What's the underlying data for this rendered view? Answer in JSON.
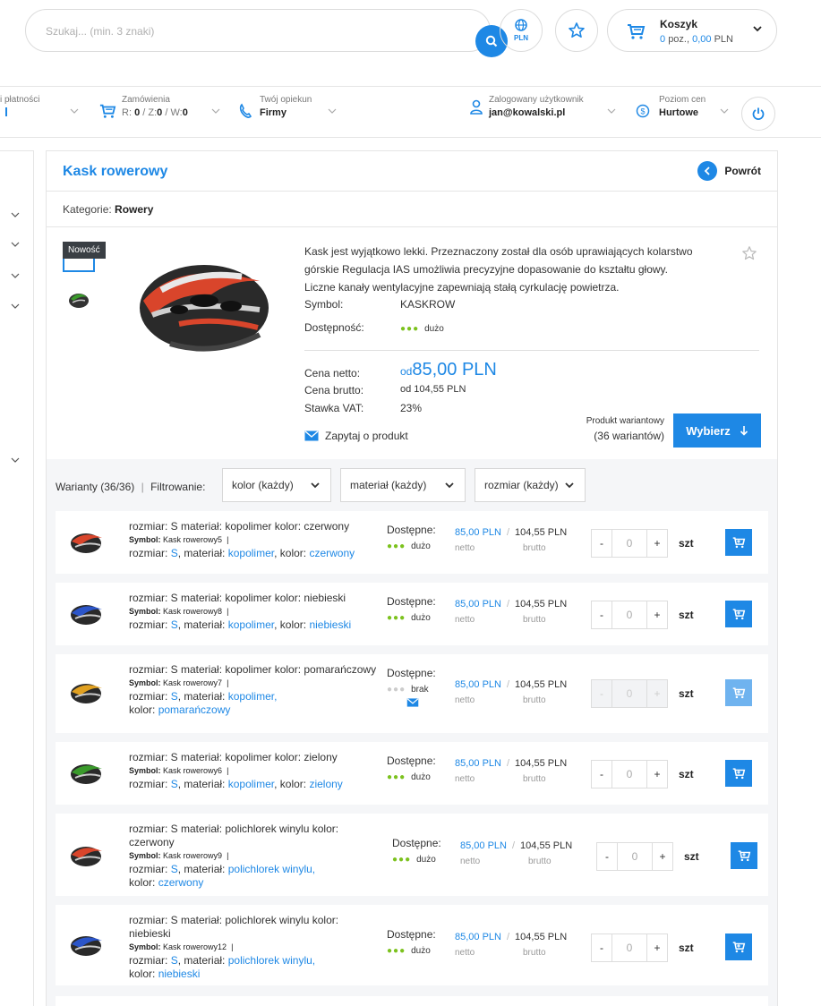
{
  "search": {
    "placeholder": "Szukaj... (min. 3 znaki)"
  },
  "currency_button": {
    "label": "PLN"
  },
  "cart": {
    "title": "Koszyk",
    "count": "0",
    "count_suffix": "poz.,",
    "amount": "0,00",
    "currency": "PLN"
  },
  "infobar": {
    "payments_fragment": "i płatności",
    "orders": {
      "label": "Zamówienia",
      "r_label": "R:",
      "r": "0",
      "z_label": "/ Z:",
      "z": "0",
      "w_label": "/ W:",
      "w": "0"
    },
    "guardian": {
      "label": "Twój opiekun",
      "value": "Firmy"
    },
    "user": {
      "label": "Zalogowany użytkownik",
      "value": "jan@kowalski.pl"
    },
    "price_level": {
      "label": "Poziom cen",
      "value": "Hurtowe"
    }
  },
  "product": {
    "title": "Kask rowerowy",
    "back_label": "Powrót",
    "category_label": "Kategorie:",
    "category": "Rowery",
    "badge": "Nowość",
    "description": "Kask jest wyjątkowo lekki. Przeznaczony został dla osób uprawiających kolarstwo górskie Regulacja IAS umożliwia precyzyjne dopasowanie do kształtu głowy. Liczne kanały wentylacyjne zapewniają stałą cyrkulację powietrza.",
    "symbol_label": "Symbol:",
    "symbol": "KASKROW",
    "availability_label": "Dostępność:",
    "availability": "dużo",
    "net_label": "Cena netto:",
    "net_prefix": "od",
    "net_price": "85,00 PLN",
    "gross_label": "Cena brutto:",
    "gross_price": "od 104,55 PLN",
    "vat_label": "Stawka VAT:",
    "vat": "23%",
    "ask_label": "Zapytaj o produkt",
    "variant_note": "Produkt wariantowy",
    "variant_count": "(36 wariantów)",
    "choose_label": "Wybierz"
  },
  "variants": {
    "count_label": "Warianty (36/36)",
    "filter_label": "Filtrowanie:",
    "filters": [
      "kolor (każdy)",
      "materiał (każdy)",
      "rozmiar (każdy)"
    ],
    "available_label": "Dostępne:",
    "net_sub": "netto",
    "gross_sub": "brutto",
    "unit": "szt",
    "symbol_label": "Symbol:",
    "size_label": "rozmiar:",
    "material_label": "materiał:",
    "color_label": "kolor:",
    "rows": [
      {
        "title": "rozmiar: S materiał: kopolimer kolor: czerwony",
        "symbol": "Kask rowerowy5",
        "size": "S",
        "material": "kopolimer",
        "color": "czerwony",
        "stock": "dużo",
        "net": "85,00 PLN",
        "gross": "104,55 PLN",
        "qty": "0",
        "minus": "-",
        "plus": "+",
        "helmet_color": "#d9452b"
      },
      {
        "title": "rozmiar: S materiał: kopolimer kolor: niebieski",
        "symbol": "Kask rowerowy8",
        "size": "S",
        "material": "kopolimer",
        "color": "niebieski",
        "stock": "dużo",
        "net": "85,00 PLN",
        "gross": "104,55 PLN",
        "qty": "0",
        "minus": "-",
        "plus": "+",
        "helmet_color": "#2b55c9"
      },
      {
        "title": "rozmiar: S materiał: kopolimer kolor: pomarańczowy",
        "symbol": "Kask rowerowy7",
        "size": "S",
        "material": "kopolimer,",
        "color": "pomarańczowy",
        "stock": "brak",
        "net": "85,00 PLN",
        "gross": "104,55 PLN",
        "qty": "0",
        "minus": "-",
        "plus": "+",
        "helmet_color": "#e0a020"
      },
      {
        "title": "rozmiar: S materiał: kopolimer kolor: zielony",
        "symbol": "Kask rowerowy6",
        "size": "S",
        "material": "kopolimer",
        "color": "zielony",
        "stock": "dużo",
        "net": "85,00 PLN",
        "gross": "104,55 PLN",
        "qty": "0",
        "minus": "-",
        "plus": "+",
        "helmet_color": "#3a9a2b"
      },
      {
        "title": "rozmiar: S materiał: polichlorek winylu kolor: czerwony",
        "symbol": "Kask rowerowy9",
        "size": "S",
        "material": "polichlorek winylu,",
        "color": "czerwony",
        "stock": "dużo",
        "net": "85,00 PLN",
        "gross": "104,55 PLN",
        "qty": "0",
        "minus": "-",
        "plus": "+",
        "helmet_color": "#d9452b"
      },
      {
        "title": "rozmiar: S materiał: polichlorek winylu kolor: niebieski",
        "symbol": "Kask rowerowy12",
        "size": "S",
        "material": "polichlorek winylu,",
        "color": "niebieski",
        "stock": "dużo",
        "net": "85,00 PLN",
        "gross": "104,55 PLN",
        "qty": "0",
        "minus": "-",
        "plus": "+",
        "helmet_color": "#2b55c9"
      }
    ]
  },
  "colors": {
    "accent": "#1e88e5",
    "stock_ok": "#7cc21e",
    "stock_none": "#cccccc"
  }
}
